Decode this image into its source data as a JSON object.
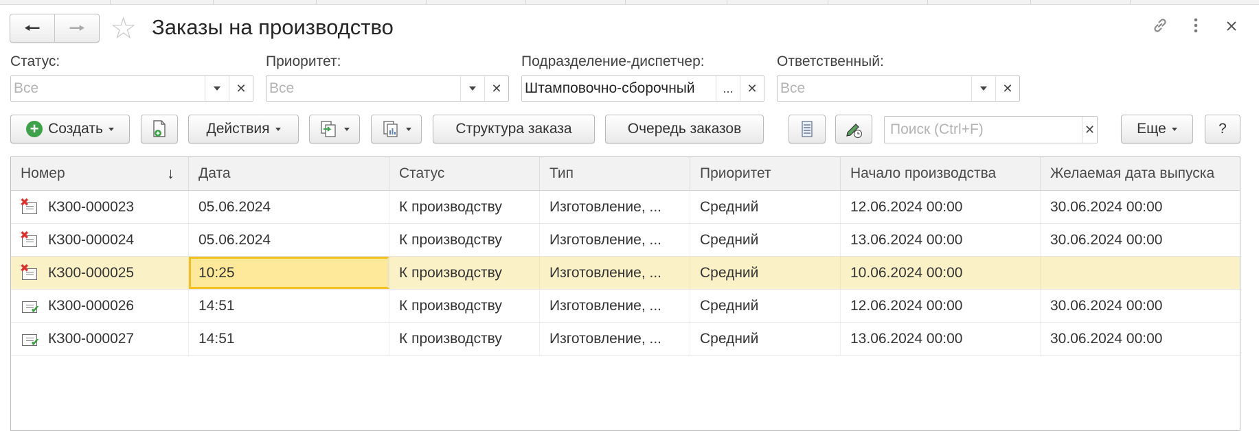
{
  "window": {
    "title": "Заказы на производство"
  },
  "filters": [
    {
      "label": "Статус:",
      "value": "",
      "placeholder": "Все",
      "has_dropdown": true
    },
    {
      "label": "Приоритет:",
      "value": "",
      "placeholder": "Все",
      "has_dropdown": true
    },
    {
      "label": "Подразделение-диспетчер:",
      "value": "Штамповочно-сборочный",
      "placeholder": "",
      "has_dropdown": false
    },
    {
      "label": "Ответственный:",
      "value": "",
      "placeholder": "Все",
      "has_dropdown": true
    }
  ],
  "toolbar": {
    "create_label": "Создать",
    "actions_label": "Действия",
    "structure_label": "Структура заказа",
    "queue_label": "Очередь заказов",
    "search_placeholder": "Поиск (Ctrl+F)",
    "search_value": "",
    "more_label": "Еще",
    "help_label": "?"
  },
  "table": {
    "columns": [
      "Номер",
      "Дата",
      "Статус",
      "Тип",
      "Приоритет",
      "Начало производства",
      "Желаемая дата выпуска"
    ],
    "sort_column": "Номер",
    "rows": [
      {
        "icon": "document-marked-deletion-icon",
        "number": "КЗ00-000023",
        "date": "05.06.2024",
        "status": "К производству",
        "type": "Изготовление, ...",
        "priority": "Средний",
        "start": "12.06.2024 00:00",
        "release": "30.06.2024 00:00",
        "selected": false
      },
      {
        "icon": "document-marked-deletion-icon",
        "number": "КЗ00-000024",
        "date": "05.06.2024",
        "status": "К производству",
        "type": "Изготовление, ...",
        "priority": "Средний",
        "start": "13.06.2024 00:00",
        "release": "30.06.2024 00:00",
        "selected": false
      },
      {
        "icon": "document-marked-deletion-icon",
        "number": "КЗ00-000025",
        "date": "10:25",
        "status": "К производству",
        "type": "Изготовление, ...",
        "priority": "Средний",
        "start": "10.06.2024 00:00",
        "release": "",
        "selected": true
      },
      {
        "icon": "document-posted-icon",
        "number": "КЗ00-000026",
        "date": "14:51",
        "status": "К производству",
        "type": "Изготовление, ...",
        "priority": "Средний",
        "start": "12.06.2024 00:00",
        "release": "30.06.2024 00:00",
        "selected": false
      },
      {
        "icon": "document-posted-icon",
        "number": "КЗ00-000027",
        "date": "14:51",
        "status": "К производству",
        "type": "Изготовление, ...",
        "priority": "Средний",
        "start": "13.06.2024 00:00",
        "release": "30.06.2024 00:00",
        "selected": false
      }
    ]
  },
  "colors": {
    "selected_row": "#fbf1c7",
    "active_cell_border": "#f4c020",
    "create_icon": "#3ea24a",
    "deletion_mark": "#e0302c",
    "posted_mark": "#2e9e3a"
  }
}
